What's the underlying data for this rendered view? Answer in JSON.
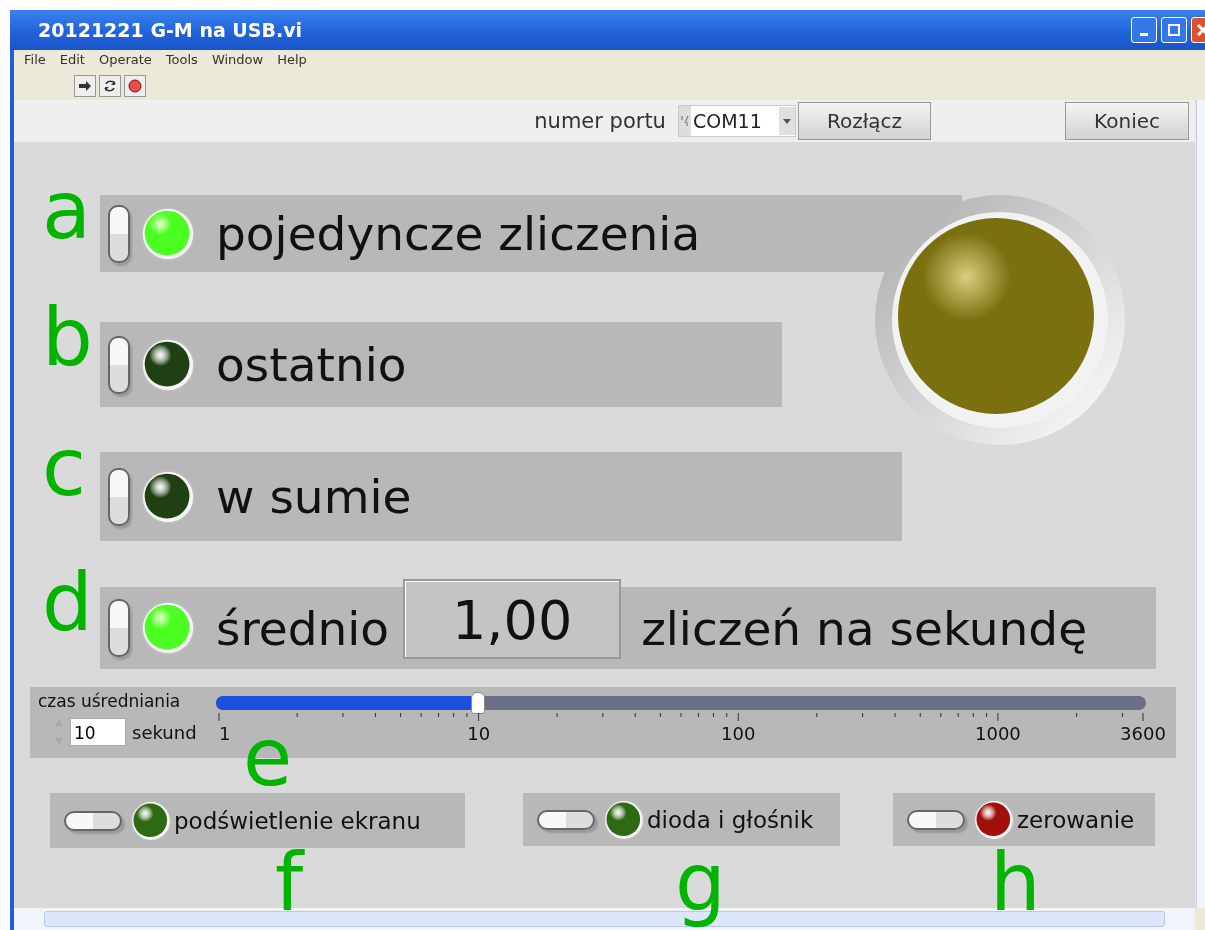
{
  "window": {
    "title": "20121221 G-M na USB.vi"
  },
  "menu": [
    "File",
    "Edit",
    "Operate",
    "Tools",
    "Window",
    "Help"
  ],
  "port": {
    "label": "numer portu",
    "value": "COM11"
  },
  "buttons": [
    "Rozłącz",
    "Koniec"
  ],
  "rows": [
    {
      "letter": "a",
      "label": "pojedyncze zliczenia",
      "switch_on": false,
      "on": true
    },
    {
      "letter": "b",
      "label": "ostatnio",
      "switch_on": false,
      "on": false
    },
    {
      "letter": "c",
      "label": "w sumie",
      "switch_on": false,
      "on": false
    },
    {
      "letter": "d",
      "label": "średnio",
      "switch_on": false,
      "on": true,
      "value": "1,00",
      "suffix": "zliczeń na sekundę"
    }
  ],
  "big_led": {
    "on": false
  },
  "averaging": {
    "label": "czas uśredniania",
    "value": "10",
    "unit": "sekund",
    "letter": "e",
    "level": 0.281,
    "ticks": [
      "1",
      "10",
      "100",
      "1000",
      "3600"
    ]
  },
  "switches": [
    {
      "letter": "f",
      "label": "podświetlenie ekranu",
      "switch_on": false,
      "on": false,
      "color": "#2e6a12"
    },
    {
      "letter": "g",
      "label": "dioda i głośnik",
      "switch_on": false,
      "on": false,
      "color": "#2e6a12"
    },
    {
      "letter": "h",
      "label": "zerowanie",
      "switch_on": false,
      "on": false,
      "color": "#a01008"
    }
  ]
}
